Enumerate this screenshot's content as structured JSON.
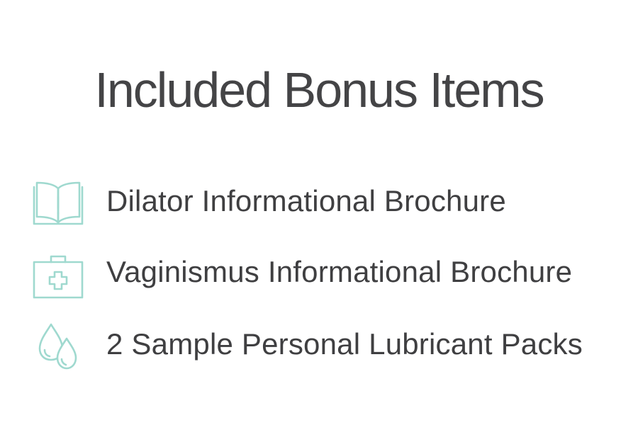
{
  "heading": "Included Bonus Items",
  "accent_color": "#9fd9cf",
  "items": [
    {
      "icon": "open-book-icon",
      "label": "Dilator Informational Brochure"
    },
    {
      "icon": "first-aid-kit-icon",
      "label": "Vaginismus Informational Brochure"
    },
    {
      "icon": "water-drops-icon",
      "label": "2 Sample Personal Lubricant Packs"
    }
  ]
}
